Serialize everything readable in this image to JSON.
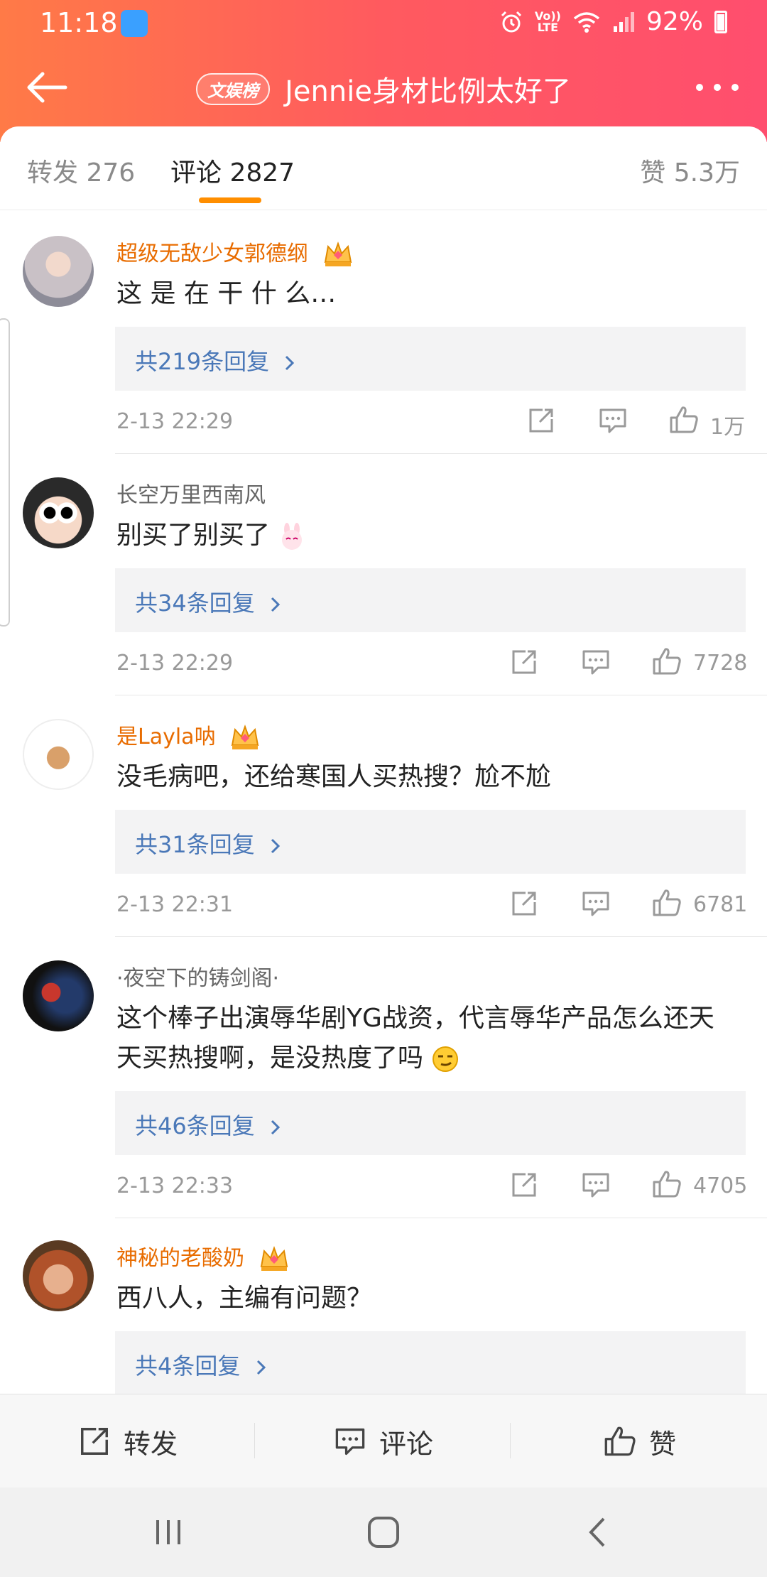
{
  "status_bar": {
    "time": "11:18",
    "volte": "Vo))",
    "lte": "LTE",
    "battery": "92%"
  },
  "header": {
    "badge": "文娱榜",
    "title": "Jennie身材比例太好了"
  },
  "tabs": {
    "repost": "转发 276",
    "comment": "评论 2827",
    "like": "赞 5.3万"
  },
  "comments": [
    {
      "username": "超级无敌少女郭德纲",
      "vip": true,
      "text": "这 是 在 干 什 么…",
      "replies": "共219条回复",
      "time": "2-13 22:29",
      "likes": "1万"
    },
    {
      "username": "长空万里西南风",
      "vip": false,
      "text": "别买了别买了",
      "replies": "共34条回复",
      "time": "2-13 22:29",
      "likes": "7728"
    },
    {
      "username": "是Layla呐",
      "vip": true,
      "text": "没毛病吧，还给寒国人买热搜？尬不尬",
      "replies": "共31条回复",
      "time": "2-13 22:31",
      "likes": "6781"
    },
    {
      "username": "·夜空下的铸剑阁·",
      "vip": false,
      "text": "这个棒子出演辱华剧YG战资，代言辱华产品怎么还天天买热搜啊，是没热度了吗",
      "replies": "共46条回复",
      "time": "2-13 22:33",
      "likes": "4705"
    },
    {
      "username": "神秘的老酸奶",
      "vip": true,
      "text": "西八人，主编有问题？",
      "replies": "共4条回复",
      "time": "",
      "likes": ""
    }
  ],
  "bottom_bar": {
    "repost": "转发",
    "comment": "评论",
    "like": "赞"
  },
  "colors": {
    "header_gradient_start": "#ff7a47",
    "header_gradient_end": "#ff4e6e",
    "vip_name": "#e86c00",
    "reply_link": "#4a78b8",
    "tab_indicator": "#ff8e00"
  }
}
